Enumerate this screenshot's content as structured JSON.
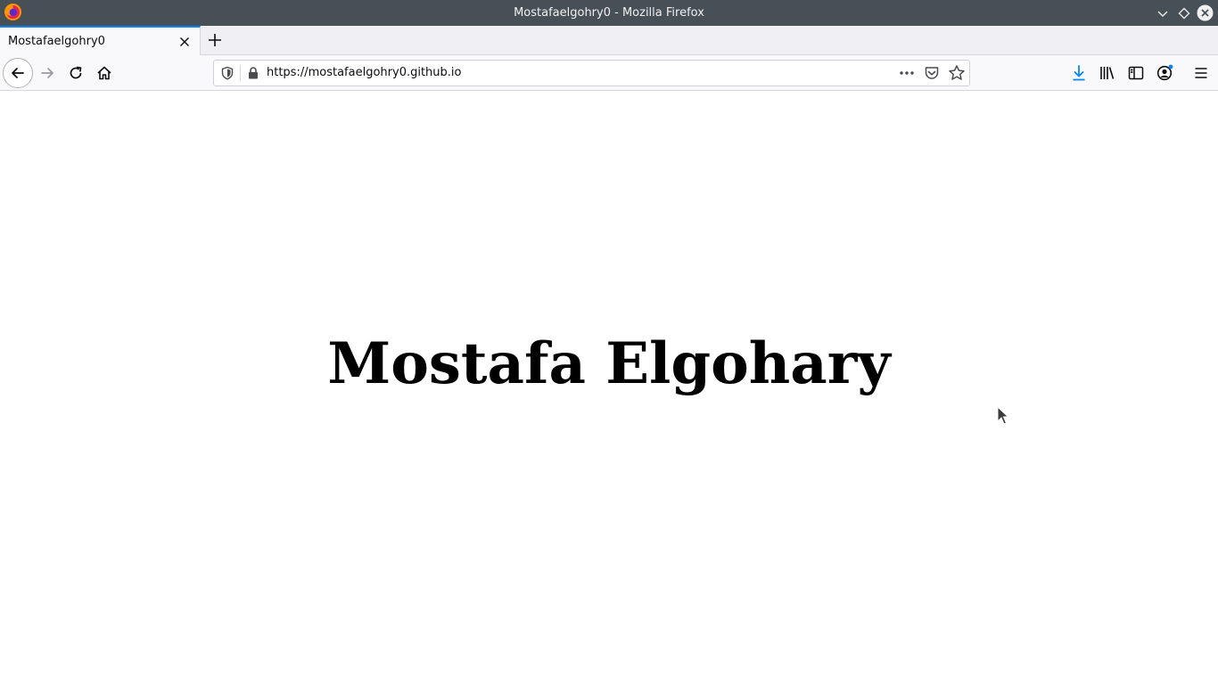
{
  "window": {
    "title": "Mostafaelgohry0 - Mozilla Firefox",
    "controls": [
      "minimize-icon",
      "maximize-icon",
      "close-icon"
    ]
  },
  "tabs": [
    {
      "label": "Mostafaelgohry0",
      "active": true
    }
  ],
  "urlbar": {
    "url": "https://mostafaelgohry0.github.io"
  },
  "page": {
    "heading": "Mostafa Elgohary"
  },
  "colors": {
    "titlebar": "#475057",
    "active_tab_accent": "#0a84ff",
    "download_accent": "#0a84ff",
    "heading": "#000000"
  }
}
